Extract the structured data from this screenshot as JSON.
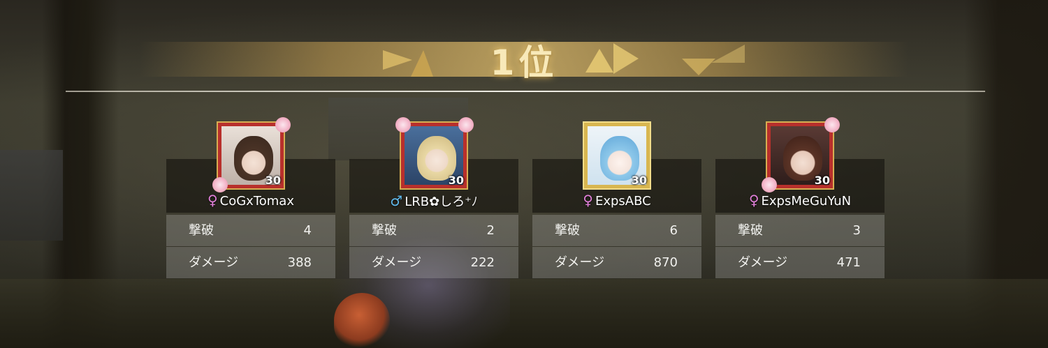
{
  "result": {
    "rank_label": "1位"
  },
  "stat_labels": {
    "kills": "撃破",
    "damage": "ダメージ"
  },
  "players": [
    {
      "name": "CoGxTomax",
      "gender_symbol": "♀",
      "gender": "female",
      "level": "30",
      "kills": "4",
      "damage": "388",
      "frame_style": "red-floral"
    },
    {
      "name": "LRB✿しろ⁺ﾉ",
      "gender_symbol": "♂",
      "gender": "male",
      "level": "30",
      "kills": "2",
      "damage": "222",
      "frame_style": "red-floral"
    },
    {
      "name": "ExpsABC",
      "gender_symbol": "♀",
      "gender": "female",
      "level": "30",
      "kills": "6",
      "damage": "870",
      "frame_style": "gold"
    },
    {
      "name": "ExpsMeGuYuN",
      "gender_symbol": "♀",
      "gender": "female",
      "level": "30",
      "kills": "3",
      "damage": "471",
      "frame_style": "red-floral"
    }
  ],
  "colors": {
    "title_gold": "#f8e9b9",
    "female_symbol": "#e07fd8",
    "male_symbol": "#5fb8ea",
    "frame_red": "#b8302c",
    "frame_gold": "#d8b650"
  }
}
